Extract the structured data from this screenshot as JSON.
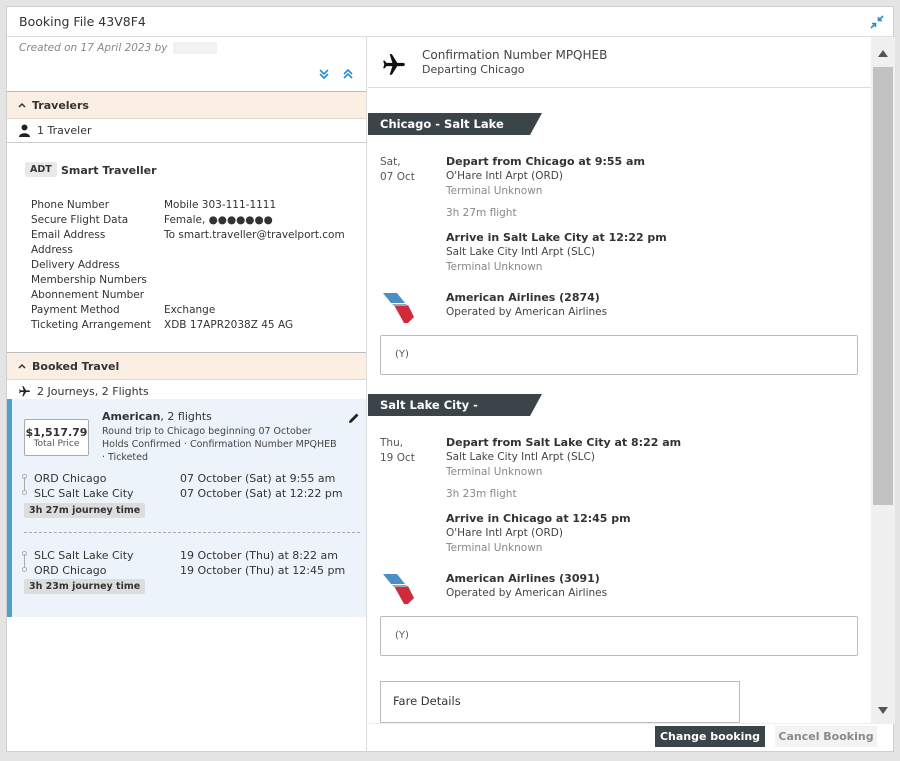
{
  "dialog": {
    "title": "Booking File 43V8F4"
  },
  "left": {
    "created_text": "Created on 17 April 2023 by",
    "travelers": {
      "title": "Travelers",
      "count": "1 Traveler",
      "type_badge": "ADT",
      "name": "Smart Traveller",
      "fields": [
        {
          "label": "Phone Number",
          "value": "Mobile 303-111-1111"
        },
        {
          "label": "Secure Flight Data",
          "value": "Female, ●●●●●●●"
        },
        {
          "label": "Email Address",
          "value": "To smart.traveller@travelport.com"
        },
        {
          "label": "Address",
          "value": ""
        },
        {
          "label": "Delivery Address",
          "value": ""
        },
        {
          "label": "Membership Numbers",
          "value": ""
        },
        {
          "label": "Abonnement Number",
          "value": ""
        },
        {
          "label": "Payment Method",
          "value": "Exchange"
        },
        {
          "label": "Ticketing Arrangement",
          "value": "XDB 17APR2038Z 45 AG"
        }
      ]
    },
    "booked_travel": {
      "title": "Booked Travel",
      "summary": "2 Journeys, 2 Flights",
      "card": {
        "price": "$1,517.79",
        "price_label": "Total Price",
        "airline": "American",
        "airline_suffix": ", 2 flights",
        "description": "Round trip to Chicago beginning 07 October",
        "status": "Holds Confirmed · Confirmation Number MPQHEB · Ticketed",
        "journeys": [
          {
            "legs": [
              {
                "city": "ORD Chicago",
                "time": "07 October (Sat) at 9:55 am"
              },
              {
                "city": "SLC Salt Lake City",
                "time": "07 October (Sat) at 12:22 pm"
              }
            ],
            "duration": "3h 27m journey time"
          },
          {
            "legs": [
              {
                "city": "SLC Salt Lake City",
                "time": "19 October (Thu) at 8:22 am"
              },
              {
                "city": "ORD Chicago",
                "time": "19 October (Thu) at 12:45 pm"
              }
            ],
            "duration": "3h 23m journey time"
          }
        ]
      }
    }
  },
  "right": {
    "confirmation": "Confirmation Number MPQHEB",
    "departing": "Departing Chicago",
    "segments": [
      {
        "route": "Chicago - Salt Lake City",
        "day": "Sat,",
        "date": "07 Oct",
        "depart": "Depart from Chicago at 9:55 am",
        "depart_airport": "O'Hare Intl Arpt (ORD)",
        "depart_terminal": "Terminal Unknown",
        "duration": "3h 27m flight",
        "arrive": "Arrive in Salt Lake City at 12:22 pm",
        "arrive_airport": "Salt Lake City Intl Arpt (SLC)",
        "arrive_terminal": "Terminal Unknown",
        "airline": "American Airlines (2874)",
        "operated": "Operated by American Airlines",
        "class": "(Y)"
      },
      {
        "route": "Salt Lake City - Chicago",
        "day": "Thu,",
        "date": "19 Oct",
        "depart": "Depart from Salt Lake City at 8:22 am",
        "depart_airport": "Salt Lake City Intl Arpt (SLC)",
        "depart_terminal": "Terminal Unknown",
        "duration": "3h 23m flight",
        "arrive": "Arrive in Chicago at 12:45 pm",
        "arrive_airport": "O'Hare Intl Arpt (ORD)",
        "arrive_terminal": "Terminal Unknown",
        "airline": "American Airlines (3091)",
        "operated": "Operated by American Airlines",
        "class": "(Y)"
      }
    ],
    "fare_details": "Fare Details"
  },
  "footer": {
    "change_label": "Change booking",
    "cancel_label": "Cancel Booking"
  },
  "colors": {
    "dark": "#3b4549",
    "section_bg": "#fbeee2",
    "card_bg": "#edf3fb",
    "card_accent": "#4fa0cb",
    "aa_red": "#d02b3a",
    "aa_blue": "#4a8fc7"
  }
}
